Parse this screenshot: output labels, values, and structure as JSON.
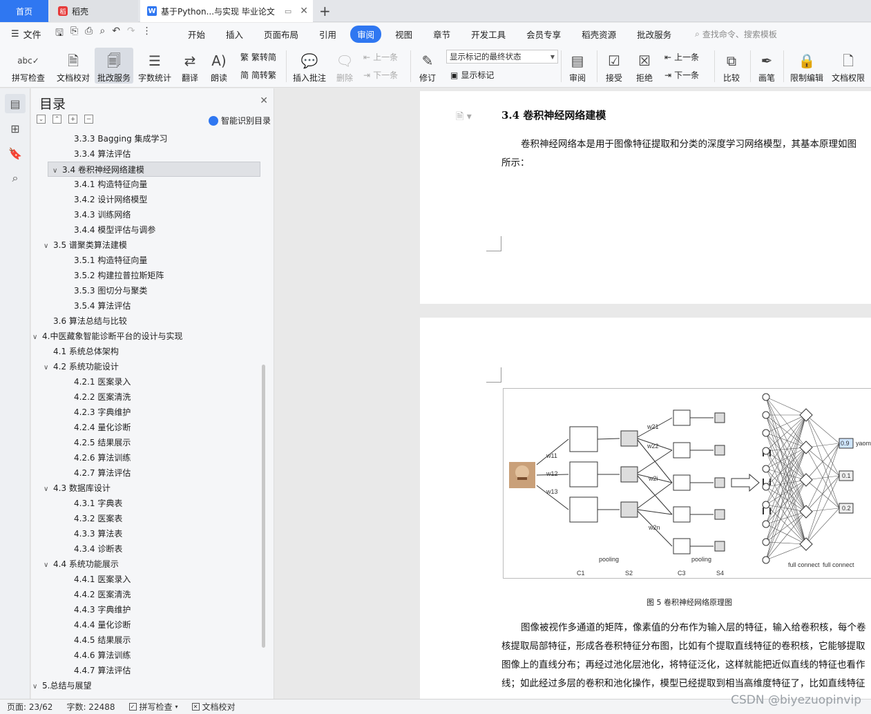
{
  "tabs": {
    "home": "首页",
    "daoke": "稻壳",
    "doc": "基于Python...与实现 毕业论文"
  },
  "menubar": {
    "file": "文件",
    "items": [
      "开始",
      "插入",
      "页面布局",
      "引用",
      "审阅",
      "视图",
      "章节",
      "开发工具",
      "会员专享",
      "稻壳资源",
      "批改服务"
    ],
    "active": "审阅",
    "search": "查找命令、搜索模板"
  },
  "ribbon": {
    "spellcheck": "拼写检查",
    "doccheck": "文档校对",
    "review_service": "批改服务",
    "wordcount": "字数统计",
    "translate": "翻译",
    "read": "朗读",
    "trad_simp": "繁转简",
    "simp_trad": "简转繁",
    "insert_comment": "插入批注",
    "delete": "删除",
    "prev": "上一条",
    "next": "下一条",
    "revise": "修订",
    "markup_state": "显示标记的最终状态",
    "show_markup": "显示标记",
    "review": "审阅",
    "accept": "接受",
    "reject": "拒绝",
    "prev2": "上一条",
    "next2": "下一条",
    "compare": "比较",
    "pen": "画笔",
    "restrict_edit": "限制编辑",
    "doc_permission": "文档权限"
  },
  "toc": {
    "title": "目录",
    "ai": "智能识别目录",
    "items": [
      {
        "label": "3.3.3 Bagging 集成学习",
        "level": 3
      },
      {
        "label": "3.3.4 算法评估",
        "level": 3
      },
      {
        "label": "3.4 卷积神经网络建模",
        "level": 2,
        "chev": true,
        "selected": true
      },
      {
        "label": "3.4.1 构造特征向量",
        "level": 3
      },
      {
        "label": "3.4.2 设计网络模型",
        "level": 3
      },
      {
        "label": "3.4.3  训练网络",
        "level": 3
      },
      {
        "label": "3.4.4 模型评估与调参",
        "level": 3
      },
      {
        "label": "3.5 谱聚类算法建模",
        "level": 2,
        "chev": true
      },
      {
        "label": "3.5.1 构造特征向量",
        "level": 3
      },
      {
        "label": "3.5.2 构建拉普拉斯矩阵",
        "level": 3
      },
      {
        "label": "3.5.3 图切分与聚类",
        "level": 3
      },
      {
        "label": "3.5.4 算法评估",
        "level": 3
      },
      {
        "label": "3.6 算法总结与比较",
        "level": 2
      },
      {
        "label": "4.中医藏象智能诊断平台的设计与实现",
        "level": 1,
        "chev": true
      },
      {
        "label": "4.1 系统总体架构",
        "level": 2
      },
      {
        "label": "4.2 系统功能设计",
        "level": 2,
        "chev": true
      },
      {
        "label": "4.2.1 医案录入",
        "level": 3
      },
      {
        "label": "4.2.2 医案清洗",
        "level": 3
      },
      {
        "label": "4.2.3 字典维护",
        "level": 3
      },
      {
        "label": "4.2.4 量化诊断",
        "level": 3
      },
      {
        "label": "4.2.5 结果展示",
        "level": 3
      },
      {
        "label": "4.2.6 算法训练",
        "level": 3
      },
      {
        "label": "4.2.7 算法评估",
        "level": 3
      },
      {
        "label": "4.3 数据库设计",
        "level": 2,
        "chev": true
      },
      {
        "label": "4.3.1 字典表",
        "level": 3
      },
      {
        "label": "4.3.2 医案表",
        "level": 3
      },
      {
        "label": "4.3.3 算法表",
        "level": 3
      },
      {
        "label": "4.3.4 诊断表",
        "level": 3
      },
      {
        "label": "4.4 系统功能展示",
        "level": 2,
        "chev": true
      },
      {
        "label": "4.4.1 医案录入",
        "level": 3
      },
      {
        "label": "4.4.2 医案清洗",
        "level": 3
      },
      {
        "label": "4.4.3 字典维护",
        "level": 3
      },
      {
        "label": "4.4.4 量化诊断",
        "level": 3
      },
      {
        "label": "4.4.5 结果展示",
        "level": 3
      },
      {
        "label": "4.4.6 算法训练",
        "level": 3
      },
      {
        "label": "4.4.7 算法评估",
        "level": 3
      },
      {
        "label": "5.总结与展望",
        "level": 1,
        "chev": true
      }
    ]
  },
  "doc": {
    "heading": "3.4 卷积神经网络建模",
    "intro_line1": "卷积神经网络本是用于图像特征提取和分类的深度学习网络模型，其基本原理如图",
    "intro_line2": "所示：",
    "caption": "图 5  卷积神经网络原理图",
    "body_lines": [
      "图像被视作多通道的矩阵，像素值的分布作为输入层的特征，输入给卷积核，每个卷",
      "核提取局部特征，形成各卷积特征分布图，比如有个提取直线特征的卷积核，它能够提取",
      "图像上的直线分布；再经过池化层池化，将特征泛化，这样就能把近似直线的特征也看作",
      "线；如此经过多层的卷积和池化操作，模型已经提取到相当高维度特征了，比如直线特征"
    ],
    "figure": {
      "labels": [
        "w11",
        "w12",
        "w13",
        "w21",
        "w22",
        "w2i",
        "w2n",
        "pooling",
        "pooling",
        "C1",
        "S2",
        "C3",
        "S4",
        "full connect",
        "full connect",
        "0.9",
        "0.1",
        "0.2",
        "yaom"
      ]
    }
  },
  "status": {
    "page": "页面: 23/62",
    "words": "字数: 22488",
    "spell": "拼写检查",
    "proof": "文档校对"
  },
  "watermark": "CSDN @biyezuopinvip"
}
